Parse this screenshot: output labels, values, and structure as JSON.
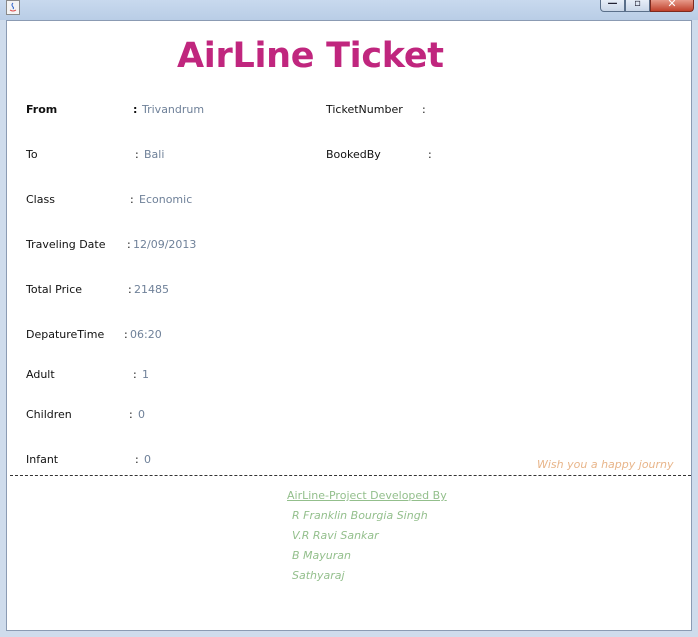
{
  "window": {
    "controls": {
      "minimize": "—",
      "maximize": "▫",
      "close": "✕"
    }
  },
  "ticket": {
    "title": "AirLine Ticket",
    "fields": {
      "from": {
        "label": "From",
        "value": "Trivandrum"
      },
      "to": {
        "label": "To",
        "value": "Bali"
      },
      "class": {
        "label": "Class",
        "value": "Economic"
      },
      "traveling_date": {
        "label": "Traveling Date",
        "value": "12/09/2013"
      },
      "total_price": {
        "label": "Total Price",
        "value": "21485"
      },
      "departure_time": {
        "label": "DepatureTime",
        "value": "06:20"
      },
      "adult": {
        "label": "Adult",
        "value": "1"
      },
      "children": {
        "label": "Children",
        "value": "0"
      },
      "infant": {
        "label": "Infant",
        "value": "0"
      },
      "ticket_number": {
        "label": "TicketNumber",
        "value": ""
      },
      "booked_by": {
        "label": "BookedBy",
        "value": ""
      }
    },
    "separator": ":",
    "wish": "Wish you a happy journy"
  },
  "credits": {
    "heading": "AirLine-Project Developed By",
    "names": [
      "R Franklin Bourgia Singh",
      "V.R Ravi Sankar",
      "B Mayuran",
      "Sathyaraj"
    ]
  },
  "colors": {
    "title": "#c0267e",
    "value_text": "#6f8199",
    "wish_text": "#e8b58a",
    "credits_text": "#93bf8c"
  }
}
